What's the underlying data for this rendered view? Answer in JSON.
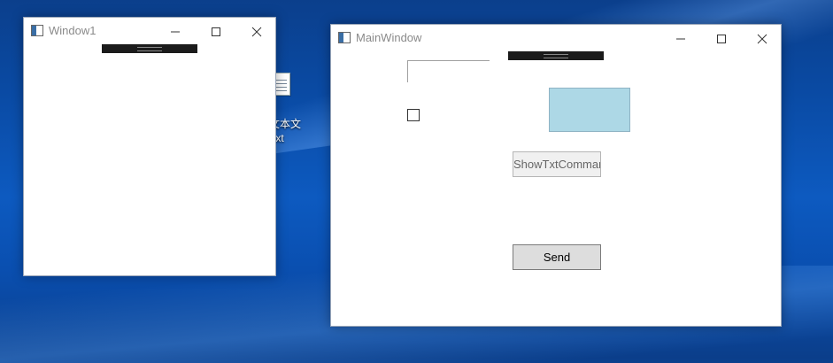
{
  "desktop": {
    "icon": {
      "name": "text-file-icon",
      "label_line1": "文本文",
      "label_line2": "txt"
    }
  },
  "window1": {
    "title": "Window1",
    "controls": {
      "minimize": "minimize-icon",
      "maximize": "maximize-icon",
      "close": "close-icon"
    }
  },
  "main_window": {
    "title": "MainWindow",
    "controls": {
      "minimize": "minimize-icon",
      "maximize": "maximize-icon",
      "close": "close-icon"
    },
    "textbox_value": "",
    "checkbox_checked": false,
    "panel_color": "#add8e6",
    "show_button_label": "ShowTxtCommand",
    "send_button_label": "Send"
  }
}
